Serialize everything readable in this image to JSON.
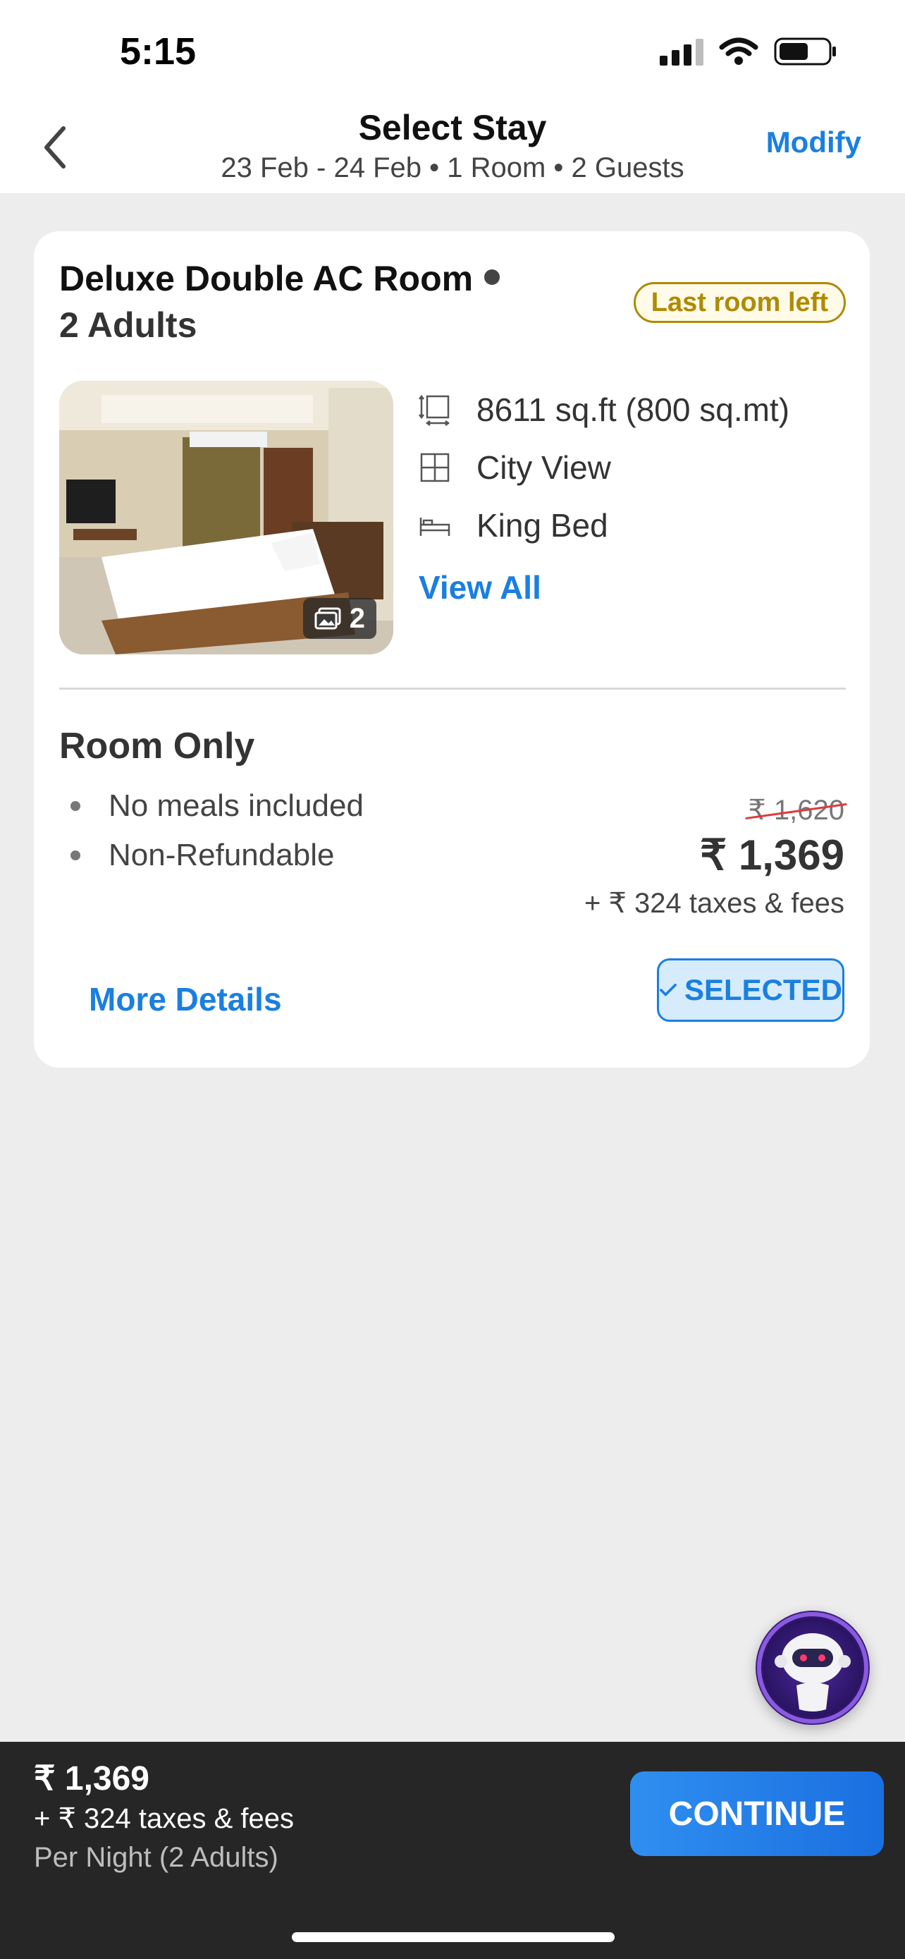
{
  "status_bar": {
    "time": "5:15"
  },
  "header": {
    "title": "Select Stay",
    "subtitle": "23 Feb - 24 Feb • 1 Room • 2 Guests",
    "modify_label": "Modify"
  },
  "room": {
    "name": "Deluxe Double AC Room",
    "occupancy": "2 Adults",
    "badge": "Last room left",
    "photo_count": "2",
    "amenities": [
      {
        "icon": "area-icon",
        "label": "8611 sq.ft (800 sq.mt)"
      },
      {
        "icon": "window-view-icon",
        "label": "City View"
      },
      {
        "icon": "bed-icon",
        "label": "King Bed"
      }
    ],
    "view_all_label": "View All"
  },
  "plan": {
    "title": "Room Only",
    "features": [
      "No meals included",
      "Non-Refundable"
    ],
    "original_price": "₹ 1,620",
    "price": "₹ 1,369",
    "taxes": "+ ₹ 324 taxes & fees",
    "more_details_label": "More Details",
    "selected_label": "SELECTED"
  },
  "footer": {
    "price": "₹ 1,369",
    "taxes": "+ ₹ 324 taxes & fees",
    "per_night": "Per Night (2 Adults)",
    "continue_label": "CONTINUE"
  },
  "colors": {
    "accent": "#1a7fe0",
    "badge": "#b08a00",
    "strike": "#e03a3a",
    "footer_bg": "#262626"
  }
}
